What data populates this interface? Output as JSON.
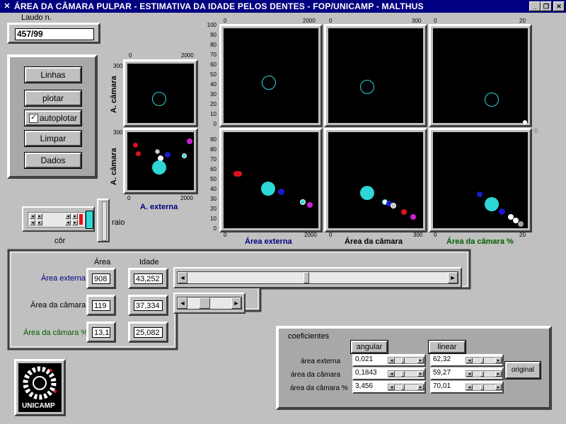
{
  "window": {
    "title": "ÁREA DA CÂMARA PULPAR - ESTIMATIVA DA IDADE PELOS DENTES - FOP/UNICAMP - MALTHUS",
    "minimize": "_",
    "restore": "❐",
    "close": "✕"
  },
  "laudo": {
    "label": "Laudo n.",
    "value": "457/99"
  },
  "buttons": {
    "linhas": "Linhas",
    "plotar": "plotar",
    "autoplotar": "autoplotar",
    "autoplotar_checked": true,
    "limpar": "Limpar",
    "dados": "Dados"
  },
  "small_plots": {
    "top": {
      "ylabel": "A. câmara",
      "ytick": "300",
      "xtick_max": "2000"
    },
    "bottom": {
      "ylabel": "A. câmara",
      "ytick": "300",
      "xtick_min": "0",
      "xtick_max": "2000",
      "xlabel": "A. externa"
    }
  },
  "color_control": {
    "cor_label": "côr",
    "raio_label": "raio"
  },
  "main_plots": {
    "y_ticks": [
      "100",
      "90",
      "80",
      "70",
      "60",
      "50",
      "40",
      "30",
      "20",
      "10",
      "0"
    ],
    "y_ticks_bottom": [
      "90",
      "80",
      "70",
      "60",
      "50",
      "40",
      "30",
      "20",
      "10",
      "0"
    ],
    "col1": {
      "xmin": "0",
      "xmax": "2000",
      "xlabel": "Área externa"
    },
    "col2": {
      "xmin": "0",
      "xmax": "300",
      "xlabel": "Área da câmara"
    },
    "col3": {
      "xmin": "0",
      "xmax": "20",
      "xlabel": "Área da câmara %"
    }
  },
  "results": {
    "area_header": "Área",
    "idade_header": "Idade",
    "rows": [
      {
        "label": "Área externa",
        "area": "908",
        "idade": "43,252"
      },
      {
        "label": "Área da câmara",
        "area": "119",
        "idade": "37,334"
      },
      {
        "label": "Área da câmara %",
        "area": "13,1",
        "idade": "25,082"
      }
    ]
  },
  "coeficientes": {
    "title": "coeficientes",
    "angular_label": "angular",
    "linear_label": "linear",
    "original_label": "original",
    "rows": [
      {
        "label": "área externa",
        "angular": "0,021",
        "linear": "62,32"
      },
      {
        "label": "área da câmara",
        "angular": "0,1843",
        "linear": "59,27"
      },
      {
        "label": "área da câmara %",
        "angular": "3,456",
        "linear": "70,01"
      }
    ]
  },
  "logo": {
    "text": "UNICAMP"
  },
  "colors": {
    "titlebar": "#000080",
    "cyan": "#2ed6d6",
    "blue": "#1a1acc",
    "red": "#e01020",
    "magenta": "#d020d0",
    "darkblue_label": "#000080",
    "green_label": "#006000"
  }
}
